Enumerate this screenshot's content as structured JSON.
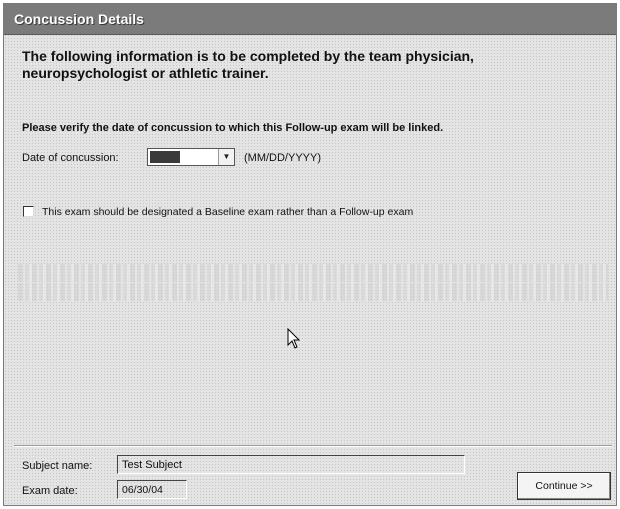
{
  "window": {
    "title": "Concussion Details"
  },
  "instructions": {
    "heading": "The following information is to be completed by the team physician, neuropsychologist or athletic trainer.",
    "verify_text": "Please verify the date of concussion to which this Follow-up exam will be linked."
  },
  "concussion_date": {
    "label": "Date of concussion:",
    "value": "",
    "format_hint": "(MM/DD/YYYY)"
  },
  "baseline_option": {
    "label": "This exam should be designated a Baseline exam rather than a Follow-up exam",
    "checked": false
  },
  "footer": {
    "subject_label": "Subject name:",
    "subject_value": "Test Subject",
    "exam_label": "Exam date:",
    "exam_value": "06/30/04",
    "continue_label": "Continue >>"
  },
  "icons": {
    "dropdown": "chevron-down-icon",
    "cursor": "mouse-pointer-icon"
  }
}
